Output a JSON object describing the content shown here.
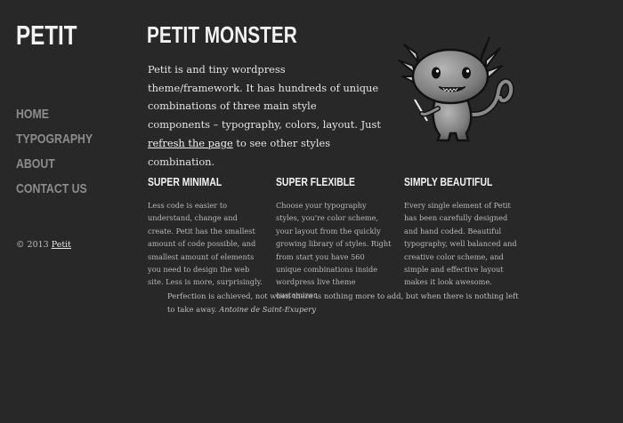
{
  "site": {
    "logo": "PETIT"
  },
  "nav": {
    "items": [
      {
        "label": "HOME"
      },
      {
        "label": "TYPOGRAPHY"
      },
      {
        "label": "ABOUT"
      },
      {
        "label": "CONTACT US"
      }
    ]
  },
  "footer": {
    "copyright": "© 2013",
    "link": "Petit"
  },
  "main": {
    "title": "PETIT MONSTER",
    "intro_before": "Petit is and tiny wordpress theme/framework. It has hundreds of unique combinations of three main style components – typography, colors, layout. Just ",
    "intro_link": "refresh the page",
    "intro_after": " to see other styles combination."
  },
  "features": [
    {
      "title": "SUPER MINIMAL",
      "text": "Less code is easier to understand, change and create. Petit has the smallest amount of code possible, and smallest amount of elements you need to design the web site. Less is more, surprisingly."
    },
    {
      "title": "SUPER FLEXIBLE",
      "text": "Choose your typography styles, you're color scheme, your layout from the quickly growing library of styles. Right from start you have 560 unique combinations inside wordpress live theme customizer."
    },
    {
      "title": "SIMPLY BEAUTIFUL",
      "text": "Every single element of Petit has been carefully designed and hand coded. Beautiful typography, well balanced and creative color scheme, and simple and effective layout makes it look awesome."
    }
  ],
  "quote": {
    "text": "Perfection is achieved, not when there is nothing more to add, but when there is nothing left to take away.",
    "author": "Antoine de Saint-Exupery"
  },
  "colors": {
    "background": "#282828",
    "heading": "#f2f2f2",
    "nav": "#8c8c8c",
    "body_text": "#b9b9b9"
  },
  "icons": {
    "mascot": "monster-mascot-icon"
  }
}
